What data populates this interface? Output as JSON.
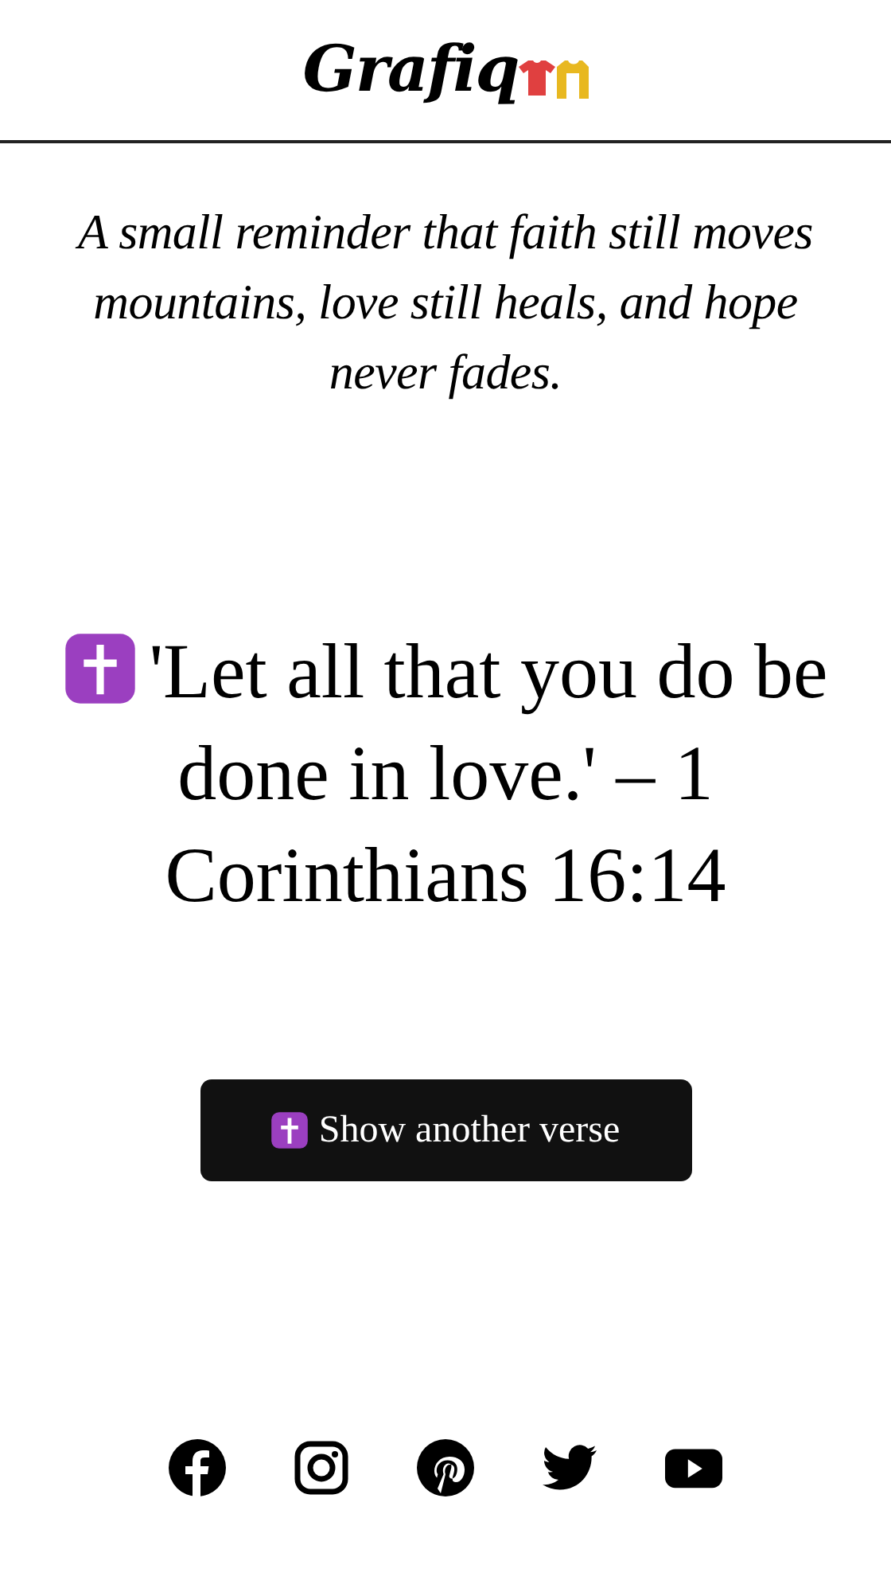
{
  "header": {
    "logo": "Grafiq"
  },
  "tagline": "A small reminder that faith still moves mountains, love still heals, and hope never fades.",
  "verse": "'Let all that you do be done in love.' – 1 Corinthians 16:14",
  "button": {
    "label": "Show another verse"
  },
  "social": [
    {
      "kind": "facebook"
    },
    {
      "kind": "instagram"
    },
    {
      "kind": "pinterest"
    },
    {
      "kind": "twitter"
    },
    {
      "kind": "youtube"
    }
  ]
}
